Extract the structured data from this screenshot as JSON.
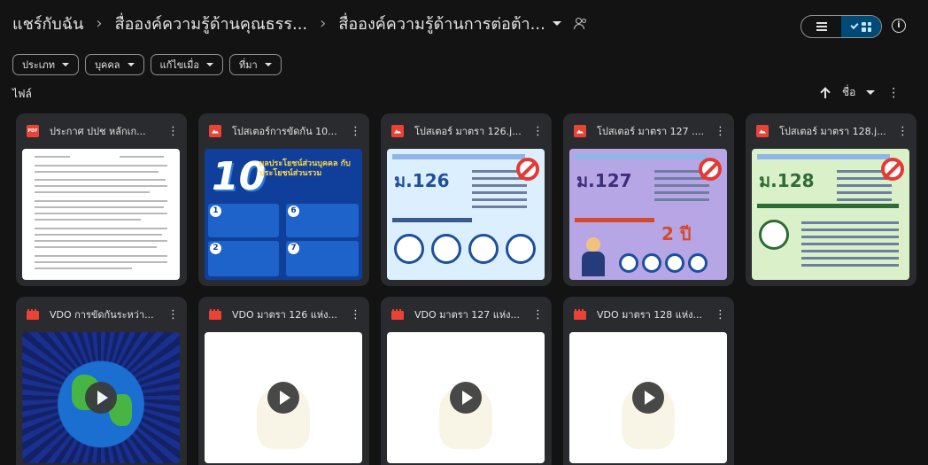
{
  "breadcrumb": {
    "root": "แชร์กับฉัน",
    "parent": "สื่อองค์ความรู้ด้านคุณธรร...",
    "current": "สื่อองค์ความรู้ด้านการต่อต้า..."
  },
  "filters": [
    "ประเภท",
    "บุคคล",
    "แก้ไขเมื่อ",
    "ที่มา"
  ],
  "section_title": "ไฟล์",
  "sort_label": "ชื่อ",
  "files": [
    {
      "name": "ประกาศ ปปช หลักเก...",
      "type": "pdf",
      "type_label": "PDF"
    },
    {
      "name": "โปสเตอร์การขัดกัน 10...",
      "type": "image"
    },
    {
      "name": "โปสเตอร์ มาตรา 126.j...",
      "type": "image"
    },
    {
      "name": "โปสเตอร์ มาตรา 127 ....",
      "type": "image"
    },
    {
      "name": "โปสเตอร์ มาตรา 128.j...",
      "type": "image"
    },
    {
      "name": "VDO การขัดกันระหว่า...",
      "type": "video"
    },
    {
      "name": "VDO มาตรา 126 แห่ง...",
      "type": "video"
    },
    {
      "name": "VDO มาตรา 127 แห่ง...",
      "type": "video"
    },
    {
      "name": "VDO มาตรา 128 แห่ง...",
      "type": "video"
    }
  ],
  "thumbnails": {
    "poster10_number": "10",
    "poster10_title": "ผลประโยชน์ส่วนบุคคล กับ ประโยชน์ส่วนรวม",
    "law126_title": "ม.126",
    "law127_title": "ม.127",
    "law127_years": "2 ปี",
    "law128_title": "ม.128"
  },
  "colors": {
    "background": "#131314",
    "card": "#2a2b2e",
    "toggle_active": "#004a77",
    "file_icon": "#ea4335"
  }
}
